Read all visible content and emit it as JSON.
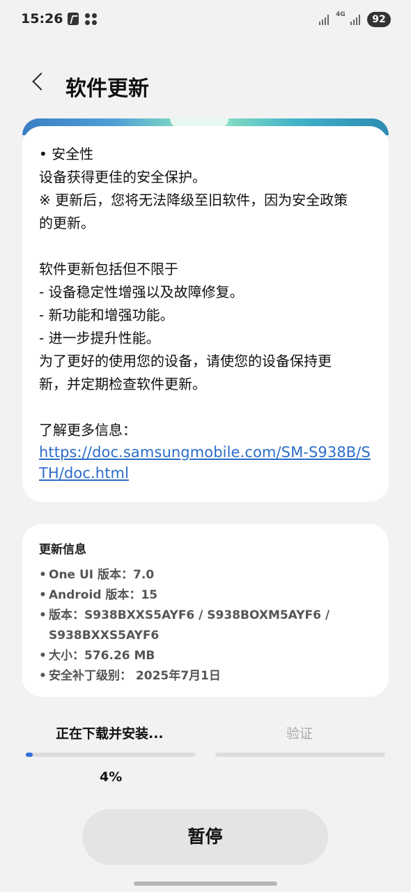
{
  "status_bar": {
    "time": "15:26",
    "network": "4G",
    "battery": "92"
  },
  "header": {
    "title": "软件更新"
  },
  "release_notes": {
    "lines": [
      "• 安全性",
      "设备获得更佳的安全保护。",
      "※ 更新后，您将无法降级至旧软件，因为安全政策",
      "的更新。",
      "",
      "软件更新包括但不限于",
      "- 设备稳定性增强以及故障修复。",
      "- 新功能和增强功能。",
      "- 进一步提升性能。",
      "为了更好的使用您的设备，请使您的设备保持更",
      "新，并定期检查软件更新。",
      "",
      "了解更多信息："
    ],
    "link": "https://doc.samsungmobile.com/SM-S938B/STH/doc.html"
  },
  "update_info": {
    "title": "更新信息",
    "items": [
      "One UI 版本：7.0",
      "Android 版本：15",
      "版本：S938BXXS5AYF6 / S938BOXM5AYF6 /\nS938BXXS5AYF6",
      "大小：576.26 MB",
      "安全补丁级别： 2025年7月1日"
    ]
  },
  "progress": {
    "step_active": "正在下载并安装...",
    "step_pending": "验证",
    "percent_text": "4%",
    "fraction": 0.04
  },
  "actions": {
    "pause_label": "暂停"
  },
  "colors": {
    "accent": "#2f6fd8",
    "link": "#2b6cc9",
    "background": "#f2f2f2"
  }
}
